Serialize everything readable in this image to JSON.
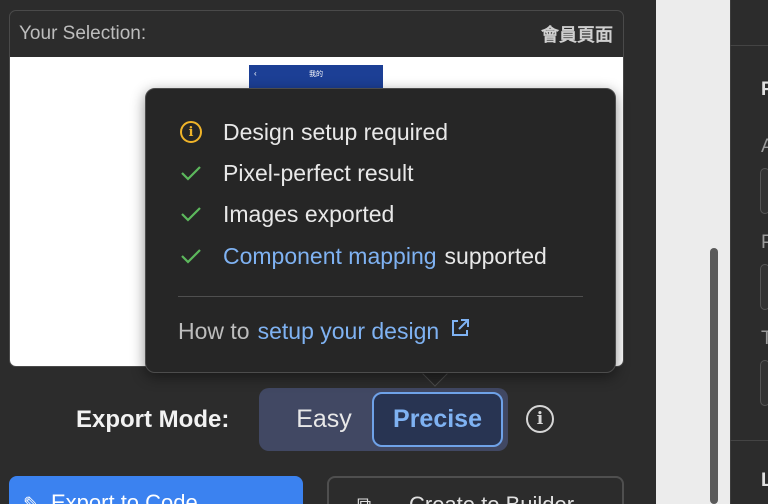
{
  "selection": {
    "label": "Your Selection:",
    "page_name": "會員頁面",
    "thumbnail": {
      "back": "‹",
      "title": "我的"
    }
  },
  "tooltip": {
    "items": [
      {
        "icon": "info-warning-icon",
        "text": "Design setup required"
      },
      {
        "icon": "check-icon",
        "text": "Pixel-perfect result"
      },
      {
        "icon": "check-icon",
        "text": "Images exported"
      },
      {
        "icon": "check-icon",
        "link": "Component mapping",
        "text": "supported"
      }
    ],
    "howto_prefix": "How to",
    "howto_link": "setup your design"
  },
  "export_mode": {
    "label": "Export Mode:",
    "options": [
      "Easy",
      "Precise"
    ],
    "selected": "Precise"
  },
  "buttons": {
    "export_code": "Export to Code",
    "create_builder": "Create to Builder"
  },
  "side_panel": {
    "letters": [
      "P",
      "A",
      "P",
      "T",
      "L"
    ]
  },
  "colors": {
    "accent": "#7fb2f2",
    "warning": "#f0b429",
    "success": "#5cb85c",
    "primary_button": "#3b82f0",
    "toggle_bg": "#414863"
  }
}
